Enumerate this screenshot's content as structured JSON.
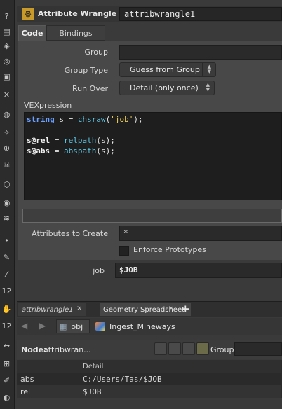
{
  "header": {
    "node_type": "Attribute Wrangle",
    "node_name": "attribwrangle1"
  },
  "tabs": [
    "Code",
    "Bindings"
  ],
  "params": {
    "group_label": "Group",
    "group_value": "",
    "group_type_label": "Group Type",
    "group_type_value": "Guess from Group",
    "run_over_label": "Run Over",
    "run_over_value": "Detail (only once)",
    "vexpression_label": "VEXpression",
    "attributes_to_create_label": "Attributes to Create",
    "attributes_to_create_value": "*",
    "enforce_prototypes_label": "Enforce Prototypes",
    "enforce_prototypes_checked": false,
    "job_label": "job",
    "job_value": "$JOB"
  },
  "code": {
    "line1_kw": "string",
    "line1_mid": " s = ",
    "line1_fn": "chsraw",
    "line1_open": "(",
    "line1_str": "'job'",
    "line1_close": ");",
    "line2_attr": "s@rel",
    "line2_eq": " = ",
    "line2_fn": "relpath",
    "line2_rest": "(s);",
    "line3_attr": "s@abs",
    "line3_eq": " = ",
    "line3_fn": "abspath",
    "line3_rest": "(s);"
  },
  "pane_tabs": {
    "tab1": "attribwrangle1",
    "tab2": "Geometry Spreadsheet",
    "close": "×",
    "add": "+"
  },
  "nav": {
    "path1": "obj",
    "path2": "Ingest_Mineways"
  },
  "spreadsheet": {
    "node_prefix": "Node:",
    "node_value": "attribwran...",
    "group_label": "Group:",
    "column_header": "Detail",
    "rows": [
      {
        "name": "abs",
        "value": "C:/Users/Tas/$JOB"
      },
      {
        "name": "rel",
        "value": "$JOB"
      }
    ]
  },
  "colors": {
    "keyword": "#6aa0ff",
    "function": "#5dc9e8",
    "string": "#f2d35c",
    "wrangle_icon": "#c79a2a"
  }
}
